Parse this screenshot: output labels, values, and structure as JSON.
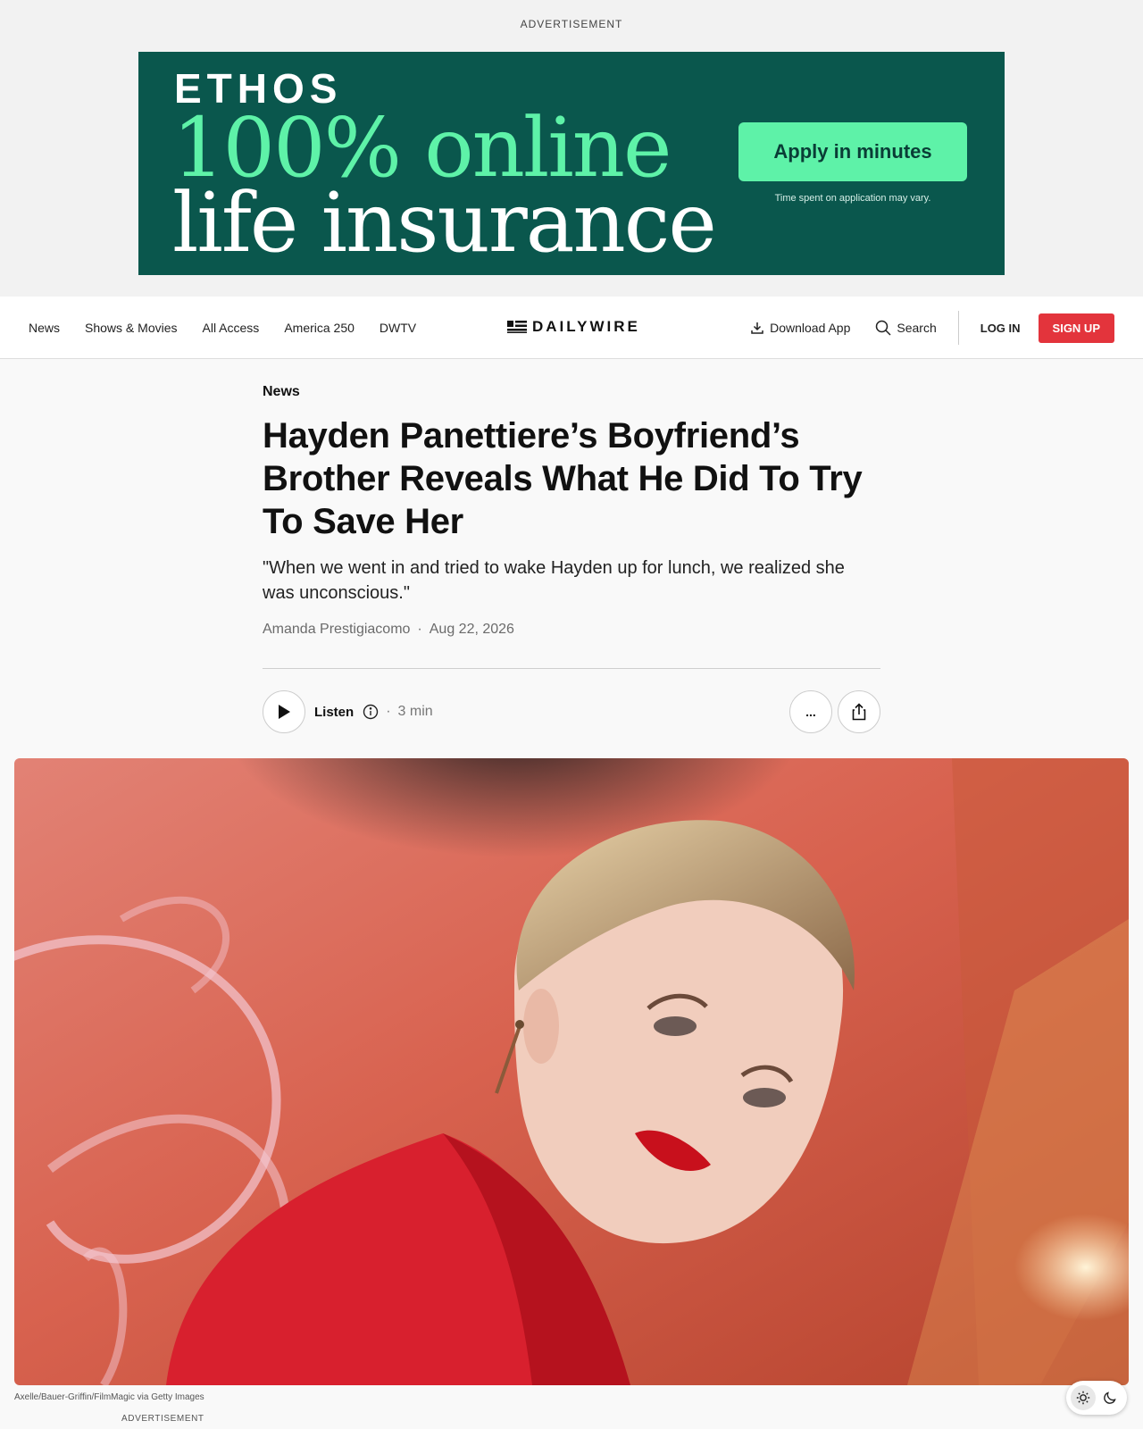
{
  "ad": {
    "label": "ADVERTISEMENT",
    "brand": "ETHOS",
    "headline_line1": "100% online",
    "headline_line2": "life insurance",
    "cta": "Apply in minutes",
    "note": "Time spent on application may vary.",
    "colors": {
      "background": "#0a574d",
      "accent": "#5ef2a8"
    }
  },
  "nav": {
    "links": [
      "News",
      "Shows & Movies",
      "All Access",
      "America 250",
      "DWTV"
    ],
    "logo": "DAILYWIRE",
    "download_app": "Download App",
    "search": "Search",
    "login": "LOG IN",
    "signup": "SIGN UP",
    "colors": {
      "signup": "#e3343c"
    }
  },
  "article": {
    "kicker": "News",
    "headline": "Hayden Panettiere’s Boyfriend’s Brother Reveals What He Did To Try To Save Her",
    "dek": "\"When we went in and tried to wake Hayden up for lunch, we realized she was unconscious.\"",
    "author": "Amanda Prestigiacomo",
    "date": "Aug 22, 2026",
    "listen_label": "Listen",
    "read_time": "3 min",
    "more_label": "...",
    "image_caption": "Axelle/Bauer-Griffin/FilmMagic via Getty Images"
  },
  "footer": {
    "ad_label": "ADVERTISEMENT"
  },
  "icons": {
    "play": "play-icon",
    "info": "info-icon",
    "share": "share-icon",
    "download": "download-icon",
    "search": "search-icon",
    "sun": "sun-icon",
    "moon": "moon-icon"
  }
}
